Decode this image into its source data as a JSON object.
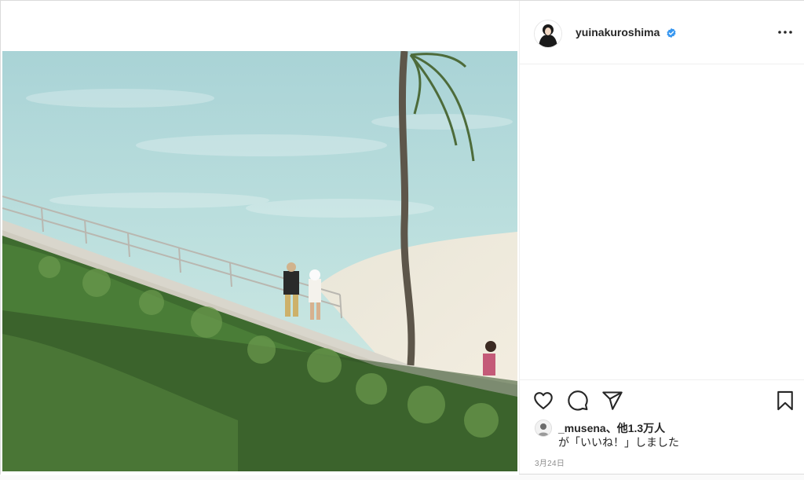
{
  "post": {
    "username": "yuinakuroshima",
    "verified": true,
    "liked_by_user": "_musena",
    "liked_by_suffix": "、他1.3万人",
    "liked_line2": "が「いいね！」しました",
    "date": "3月24日"
  },
  "icons": {
    "more": "more-options-icon",
    "like": "heart-icon",
    "comment": "comment-icon",
    "share": "share-icon",
    "save": "bookmark-icon",
    "verified": "verified-badge-icon"
  },
  "colors": {
    "verified_blue": "#3897f0",
    "text": "#262626",
    "muted": "#8e8e8e"
  }
}
